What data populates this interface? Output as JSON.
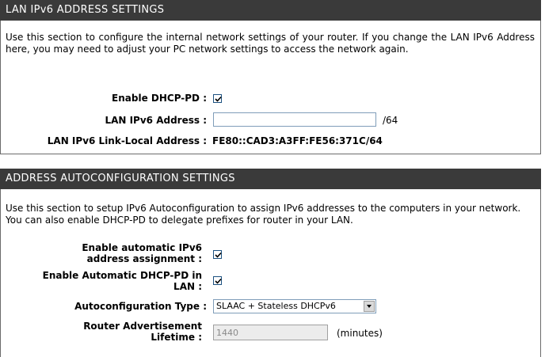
{
  "lan_section": {
    "title": "LAN IPv6 ADDRESS SETTINGS",
    "description": "Use this section to configure the internal network settings of your router. If you change the LAN IPv6 Address here, you may need to adjust your PC network settings to access the network again.",
    "enable_dhcp_pd_label": "Enable DHCP-PD :",
    "enable_dhcp_pd_checked": true,
    "lan_ipv6_address_label": "LAN IPv6 Address :",
    "lan_ipv6_address_value": "",
    "prefix_suffix": "/64",
    "link_local_label": "LAN IPv6 Link-Local Address :",
    "link_local_value": "FE80::CAD3:A3FF:FE56:371C/64"
  },
  "autoconfig_section": {
    "title": "ADDRESS AUTOCONFIGURATION SETTINGS",
    "description": "Use this section to setup IPv6 Autoconfiguration to assign IPv6 addresses to the computers in your network. You can also enable DHCP-PD to delegate prefixes for router in your LAN.",
    "auto_assign_label_line1": "Enable automatic IPv6",
    "auto_assign_label_line2": "address assignment :",
    "auto_assign_checked": true,
    "auto_dhcp_pd_label_line1": "Enable Automatic DHCP-PD in",
    "auto_dhcp_pd_label_line2": "LAN :",
    "auto_dhcp_pd_checked": true,
    "autoconfig_type_label": "Autoconfiguration Type :",
    "autoconfig_type_value": "SLAAC + Stateless DHCPv6",
    "ra_lifetime_label_line1": "Router Advertisement",
    "ra_lifetime_label_line2": "Lifetime :",
    "ra_lifetime_value": "1440",
    "ra_lifetime_unit": "(minutes)"
  }
}
